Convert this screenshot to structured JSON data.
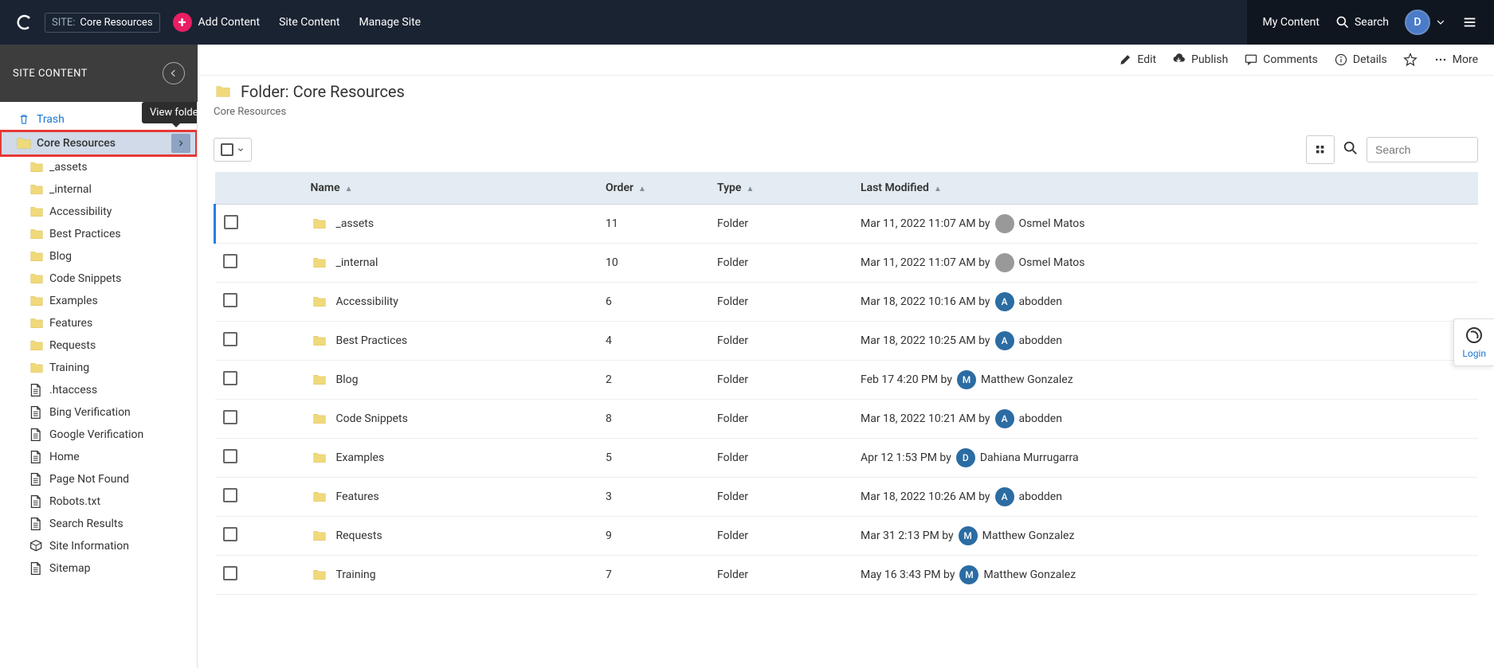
{
  "topbar": {
    "site_label": "SITE:",
    "site_name": "Core Resources",
    "add_content": "Add Content",
    "nav": [
      "Site Content",
      "Manage Site"
    ],
    "my_content": "My Content",
    "search_label": "Search",
    "user_initial": "D"
  },
  "sidebar": {
    "title": "SITE CONTENT",
    "trash": "Trash",
    "tooltip": "View folder",
    "root": "Core Resources",
    "items": [
      {
        "label": "_assets",
        "type": "folder"
      },
      {
        "label": "_internal",
        "type": "folder"
      },
      {
        "label": "Accessibility",
        "type": "folder"
      },
      {
        "label": "Best Practices",
        "type": "folder"
      },
      {
        "label": "Blog",
        "type": "folder"
      },
      {
        "label": "Code Snippets",
        "type": "folder"
      },
      {
        "label": "Examples",
        "type": "folder"
      },
      {
        "label": "Features",
        "type": "folder"
      },
      {
        "label": "Requests",
        "type": "folder"
      },
      {
        "label": "Training",
        "type": "folder"
      },
      {
        "label": ".htaccess",
        "type": "page"
      },
      {
        "label": "Bing Verification",
        "type": "page"
      },
      {
        "label": "Google Verification",
        "type": "page"
      },
      {
        "label": "Home",
        "type": "page"
      },
      {
        "label": "Page Not Found",
        "type": "page"
      },
      {
        "label": "Robots.txt",
        "type": "page"
      },
      {
        "label": "Search Results",
        "type": "page"
      },
      {
        "label": "Site Information",
        "type": "block"
      },
      {
        "label": "Sitemap",
        "type": "page"
      }
    ]
  },
  "actions": {
    "edit": "Edit",
    "publish": "Publish",
    "comments": "Comments",
    "details": "Details",
    "more": "More"
  },
  "page": {
    "title": "Folder: Core Resources",
    "breadcrumb": "Core Resources"
  },
  "toolbar": {
    "search_placeholder": "Search"
  },
  "table": {
    "headers": {
      "name": "Name",
      "order": "Order",
      "type": "Type",
      "modified": "Last Modified"
    },
    "rows": [
      {
        "name": "_assets",
        "order": "11",
        "type": "Folder",
        "modified": "Mar 11, 2022 11:07 AM by",
        "user": "Osmel Matos",
        "avatar": "img"
      },
      {
        "name": "_internal",
        "order": "10",
        "type": "Folder",
        "modified": "Mar 11, 2022 11:07 AM by",
        "user": "Osmel Matos",
        "avatar": "img"
      },
      {
        "name": "Accessibility",
        "order": "6",
        "type": "Folder",
        "modified": "Mar 18, 2022 10:16 AM by",
        "user": "abodden",
        "avatar": "A"
      },
      {
        "name": "Best Practices",
        "order": "4",
        "type": "Folder",
        "modified": "Mar 18, 2022 10:25 AM by",
        "user": "abodden",
        "avatar": "A"
      },
      {
        "name": "Blog",
        "order": "2",
        "type": "Folder",
        "modified": "Feb 17 4:20 PM by",
        "user": "Matthew Gonzalez",
        "avatar": "M"
      },
      {
        "name": "Code Snippets",
        "order": "8",
        "type": "Folder",
        "modified": "Mar 18, 2022 10:21 AM by",
        "user": "abodden",
        "avatar": "A"
      },
      {
        "name": "Examples",
        "order": "5",
        "type": "Folder",
        "modified": "Apr 12 1:53 PM by",
        "user": "Dahiana Murrugarra",
        "avatar": "D"
      },
      {
        "name": "Features",
        "order": "3",
        "type": "Folder",
        "modified": "Mar 18, 2022 10:26 AM by",
        "user": "abodden",
        "avatar": "A"
      },
      {
        "name": "Requests",
        "order": "9",
        "type": "Folder",
        "modified": "Mar 31 2:13 PM by",
        "user": "Matthew Gonzalez",
        "avatar": "M"
      },
      {
        "name": "Training",
        "order": "7",
        "type": "Folder",
        "modified": "May 16 3:43 PM by",
        "user": "Matthew Gonzalez",
        "avatar": "M"
      }
    ]
  },
  "login_tab": "Login"
}
